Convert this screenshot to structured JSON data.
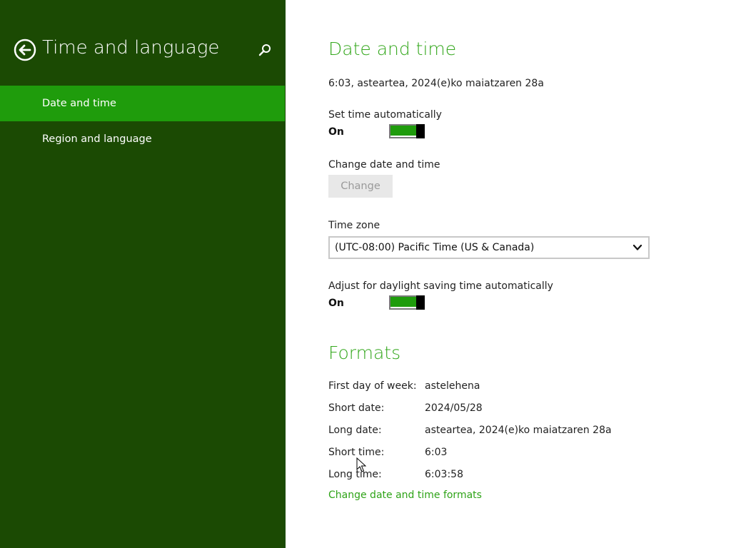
{
  "sidebar": {
    "title": "Time and language",
    "back_icon": "back-arrow-icon",
    "search_icon": "search-icon",
    "items": [
      {
        "label": "Date and time",
        "selected": true
      },
      {
        "label": "Region and language",
        "selected": false
      }
    ],
    "background": "#1b4a03",
    "selected_color": "#1f9c0c"
  },
  "date_time": {
    "title": "Date and time",
    "current": "6:03, asteartea, 2024(e)ko maiatzaren 28a",
    "set_auto_label": "Set time automatically",
    "set_auto_state": "On",
    "change_label": "Change date and time",
    "change_button": "Change",
    "timezone_label": "Time zone",
    "timezone_value": "(UTC-08:00) Pacific Time (US & Canada)",
    "dst_label": "Adjust for daylight saving time automatically",
    "dst_state": "On"
  },
  "formats": {
    "title": "Formats",
    "rows": [
      {
        "label": "First day of week:",
        "value": "astelehena"
      },
      {
        "label": "Short date:",
        "value": "2024/05/28"
      },
      {
        "label": "Long date:",
        "value": "asteartea, 2024(e)ko maiatzaren 28a"
      },
      {
        "label": "Short time:",
        "value": "6:03"
      },
      {
        "label": "Long time:",
        "value": "6:03:58"
      }
    ],
    "link": "Change date and time formats"
  },
  "colors": {
    "accent": "#35a81e",
    "toggle_on": "#1f9c0c"
  }
}
